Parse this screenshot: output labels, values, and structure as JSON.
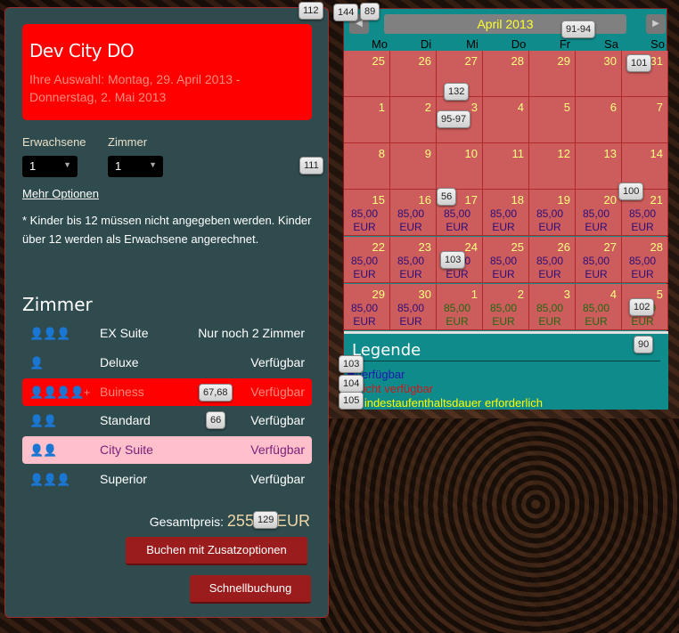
{
  "hotel": {
    "name": "Dev City DO",
    "selection": "Ihre Auswahl: Montag, 29. April 2013 - Donnerstag, 2. Mai 2013"
  },
  "form": {
    "adults_label": "Erwachsene",
    "adults_value": "1",
    "rooms_label": "Zimmer",
    "rooms_value": "1",
    "more_options": "Mehr Optionen",
    "kids_note": "* Kinder bis 12 müssen nicht angegeben werden. Kinder über 12 werden als Erwachsene angerechnet."
  },
  "rooms_heading": "Zimmer",
  "rooms": [
    {
      "name": "EX Suite",
      "status": "Nur noch 2 Zimmer",
      "persons": 3
    },
    {
      "name": "Deluxe",
      "status": "Verfügbar",
      "persons": 1
    },
    {
      "name": "Buiness",
      "status": "Verfügbar",
      "persons": 4
    },
    {
      "name": "Standard",
      "status": "Verfügbar",
      "persons": 2
    },
    {
      "name": "City Suite",
      "status": "Verfügbar",
      "persons": 2
    },
    {
      "name": "Superior",
      "status": "Verfügbar",
      "persons": 3
    }
  ],
  "total": {
    "label": "Gesamtpreis:",
    "amount": "255,00",
    "currency": "EUR"
  },
  "buttons": {
    "book_extras": "Buchen mit Zusatzoptionen",
    "quick_book": "Schnellbuchung"
  },
  "calendar": {
    "month": "April 2013",
    "weekdays": [
      "Mo",
      "Di",
      "Mi",
      "Do",
      "Fr",
      "Sa",
      "So"
    ],
    "weeks": [
      [
        {
          "d": "25"
        },
        {
          "d": "26"
        },
        {
          "d": "27"
        },
        {
          "d": "28"
        },
        {
          "d": "29"
        },
        {
          "d": "30"
        },
        {
          "d": "31"
        }
      ],
      [
        {
          "d": "1"
        },
        {
          "d": "2"
        },
        {
          "d": "3"
        },
        {
          "d": "4"
        },
        {
          "d": "5"
        },
        {
          "d": "6"
        },
        {
          "d": "7"
        }
      ],
      [
        {
          "d": "8"
        },
        {
          "d": "9"
        },
        {
          "d": "10"
        },
        {
          "d": "11"
        },
        {
          "d": "12"
        },
        {
          "d": "13"
        },
        {
          "d": "14"
        }
      ],
      [
        {
          "d": "15",
          "p": "85,00",
          "c": "EUR"
        },
        {
          "d": "16",
          "p": "85,00",
          "c": "EUR"
        },
        {
          "d": "17",
          "p": "85,00",
          "c": "EUR"
        },
        {
          "d": "18",
          "p": "85,00",
          "c": "EUR"
        },
        {
          "d": "19",
          "p": "85,00",
          "c": "EUR"
        },
        {
          "d": "20",
          "p": "85,00",
          "c": "EUR"
        },
        {
          "d": "21",
          "p": "85,00",
          "c": "EUR"
        }
      ],
      [
        {
          "d": "22",
          "p": "85,00",
          "c": "EUR"
        },
        {
          "d": "23",
          "p": "85,00",
          "c": "EUR"
        },
        {
          "d": "24",
          "p": "85,00",
          "c": "EUR"
        },
        {
          "d": "25",
          "p": "85,00",
          "c": "EUR"
        },
        {
          "d": "26",
          "p": "85,00",
          "c": "EUR"
        },
        {
          "d": "27",
          "p": "85,00",
          "c": "EUR"
        },
        {
          "d": "28",
          "p": "85,00",
          "c": "EUR"
        }
      ],
      [
        {
          "d": "29",
          "p": "85,00",
          "c": "EUR"
        },
        {
          "d": "30",
          "p": "85,00",
          "c": "EUR"
        },
        {
          "d": "1",
          "p": "85,00",
          "c": "EUR",
          "avail": true
        },
        {
          "d": "2",
          "p": "85,00",
          "c": "EUR",
          "avail": true
        },
        {
          "d": "3",
          "p": "85,00",
          "c": "EUR",
          "avail": true
        },
        {
          "d": "4",
          "p": "85,00",
          "c": "EUR",
          "avail": true
        },
        {
          "d": "5",
          "p": "85,00",
          "c": "EUR",
          "avail": true
        }
      ]
    ]
  },
  "legend": {
    "title": "Legende",
    "items": [
      {
        "label": "Verfügbar",
        "color": "#1a1ab0"
      },
      {
        "label": "Nicht verfügbar",
        "color": "#cc1a1a"
      },
      {
        "label": "Mindestaufenthaltsdauer erforderlich",
        "color": "#ffff00"
      }
    ]
  },
  "badges": [
    "112",
    "144",
    "89",
    "91-94",
    "101",
    "132",
    "95-97",
    "111",
    "56",
    "100",
    "103",
    "102",
    "90",
    "103",
    "104",
    "105",
    "67,68",
    "66",
    "129"
  ]
}
